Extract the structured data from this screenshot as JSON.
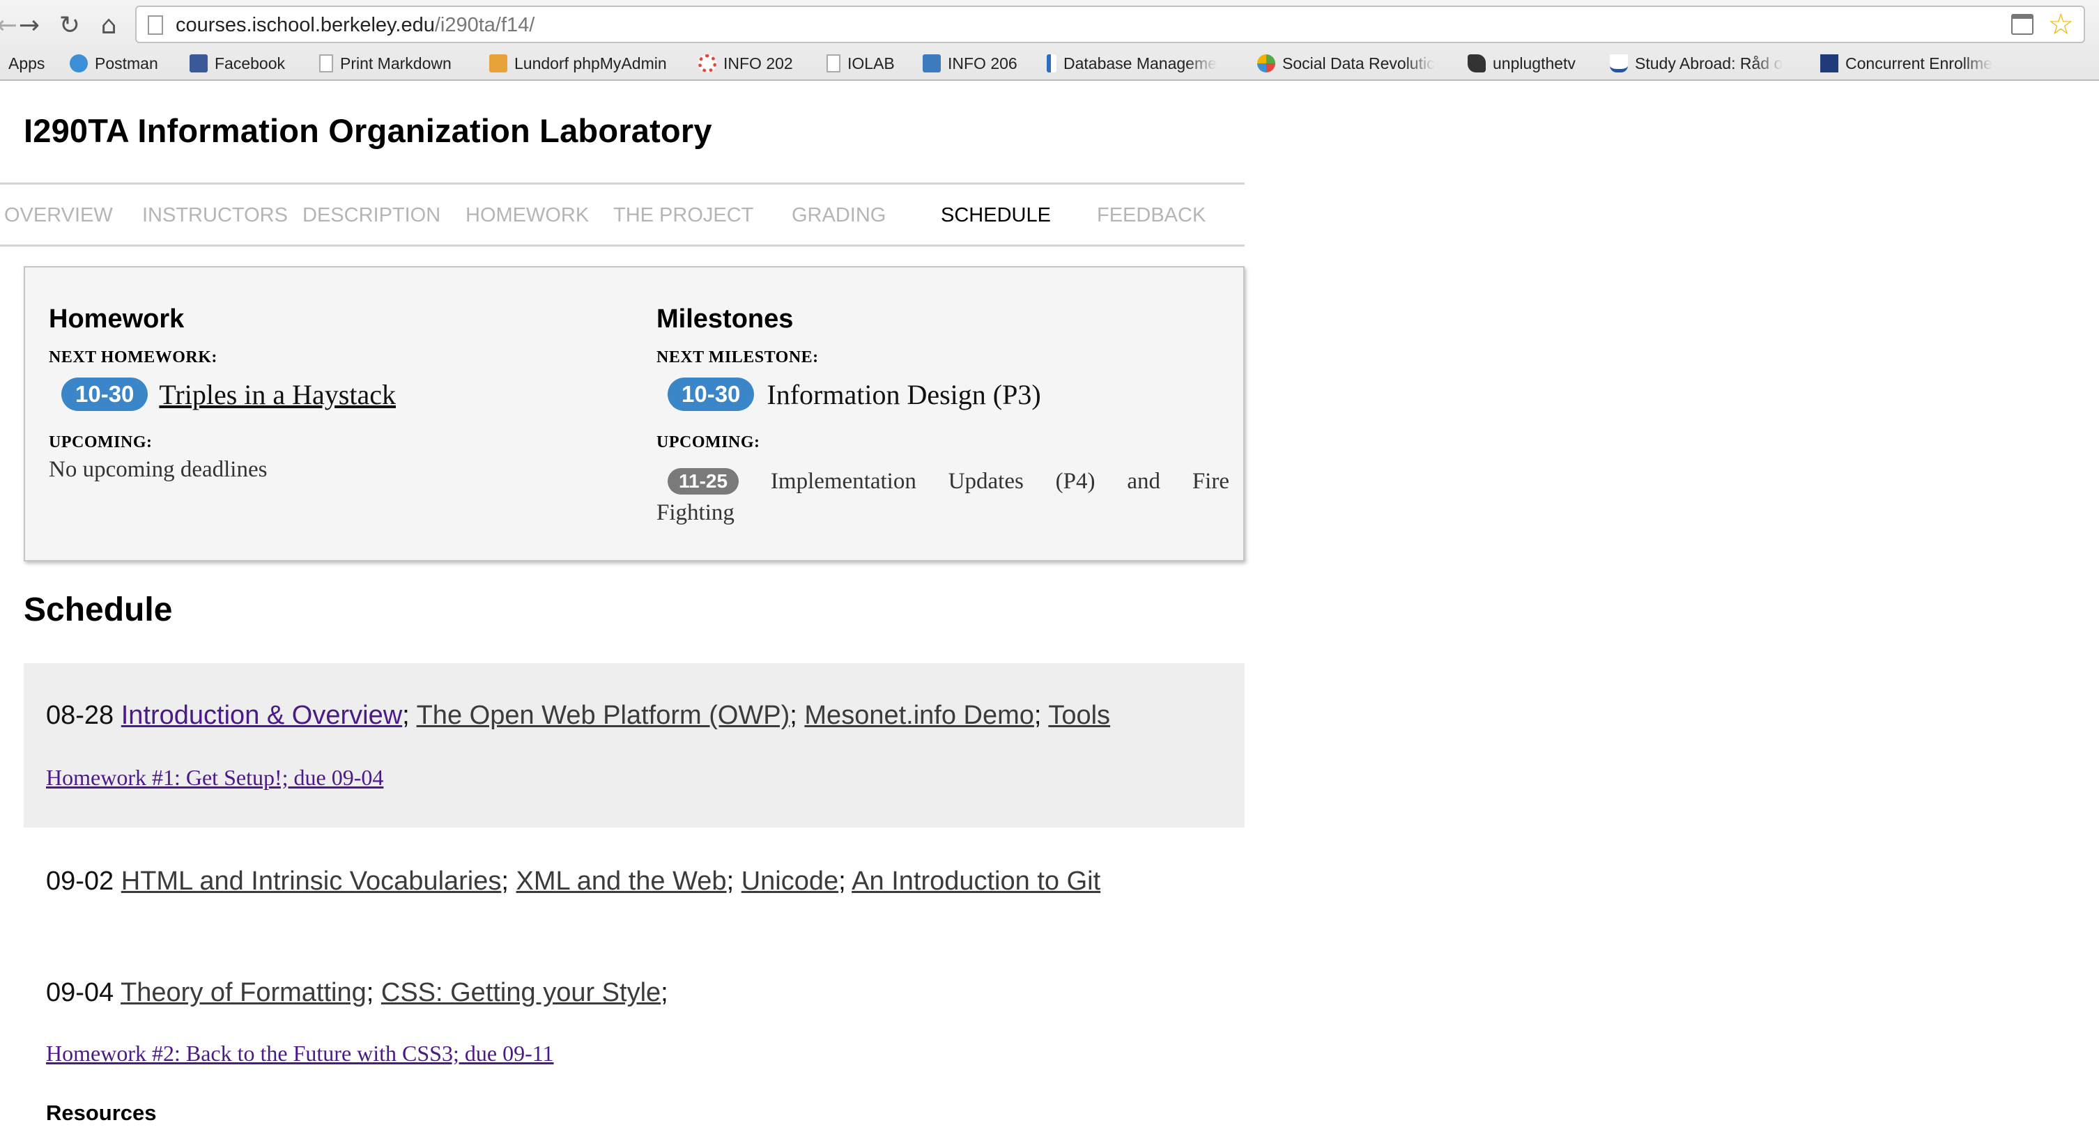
{
  "browser": {
    "url_host": "courses.ischool.berkeley.edu",
    "url_path": "/i290ta/f14/",
    "icons": {
      "back": "arrow-right-icon",
      "reload": "reload-icon",
      "home": "home-icon",
      "calendar": "calendar-icon",
      "star": "star-icon"
    },
    "bookmarks": [
      {
        "label": "Apps",
        "icon": "apps-icon",
        "color": "#666666"
      },
      {
        "label": "Postman",
        "icon": "globe-icon",
        "color": "#3b8ed8"
      },
      {
        "label": "Facebook",
        "icon": "facebook-icon",
        "color": "#3b5998"
      },
      {
        "label": "Print Markdown",
        "icon": "page-icon",
        "color": "#ffffff"
      },
      {
        "label": "Lundorf phpMyAdmin",
        "icon": "phpmyadmin-icon",
        "color": "#e8a23a"
      },
      {
        "label": "INFO 202",
        "icon": "ring-icon",
        "color": "#e04a3a"
      },
      {
        "label": "IOLAB",
        "icon": "page-icon",
        "color": "#ffffff"
      },
      {
        "label": "INFO 206",
        "icon": "piazza-icon",
        "color": "#3d7bbf"
      },
      {
        "label": "Database Manageme",
        "icon": "bracket-icon",
        "color": "#2a6ec0"
      },
      {
        "label": "Social Data Revolutic",
        "icon": "pinwheel-icon",
        "color": "#55aa44"
      },
      {
        "label": "unplugthetv",
        "icon": "plug-icon",
        "color": "#333333"
      },
      {
        "label": "Study Abroad: Råd o",
        "icon": "wave-icon",
        "color": "#2255aa"
      },
      {
        "label": "Concurrent Enrollme",
        "icon": "ucb-icon",
        "color": "#1f3b7a"
      }
    ]
  },
  "site": {
    "title": "I290TA Information Organization Laboratory",
    "nav": [
      "OVERVIEW",
      "INSTRUCTORS",
      "DESCRIPTION",
      "HOMEWORK",
      "THE PROJECT",
      "GRADING",
      "SCHEDULE",
      "FEEDBACK"
    ],
    "active_nav": "SCHEDULE"
  },
  "deadlines": {
    "homework": {
      "heading": "Homework",
      "next_label": "NEXT HOMEWORK:",
      "next_date": "10-30",
      "next_title": "Triples in a Haystack",
      "upcoming_label": "UPCOMING:",
      "upcoming_text": "No upcoming deadlines"
    },
    "milestones": {
      "heading": "Milestones",
      "next_label": "NEXT MILESTONE:",
      "next_date": "10-30",
      "next_title": "Information Design (P3)",
      "upcoming_label": "UPCOMING:",
      "upcoming_date": "11-25",
      "upcoming_line1": [
        "Implementation",
        "Updates",
        "(P4)",
        "and",
        "Fire"
      ],
      "upcoming_line2": "Fighting"
    }
  },
  "schedule": {
    "heading": "Schedule",
    "days": [
      {
        "date": "08-28",
        "topics": [
          "Introduction & Overview",
          "The Open Web Platform (OWP)",
          "Mesonet.info Demo",
          "Tools"
        ],
        "homework": "Homework #1: Get Setup!; due 09-04"
      },
      {
        "date": "09-02",
        "topics": [
          "HTML and Intrinsic Vocabularies",
          "XML and the Web",
          "Unicode",
          "An Introduction to Git"
        ]
      },
      {
        "date": "09-04",
        "topics": [
          "Theory of Formatting",
          "CSS: Getting your Style"
        ],
        "homework": "Homework #2: Back to the Future with CSS3; due 09-11",
        "resources_heading": "Resources"
      }
    ]
  }
}
